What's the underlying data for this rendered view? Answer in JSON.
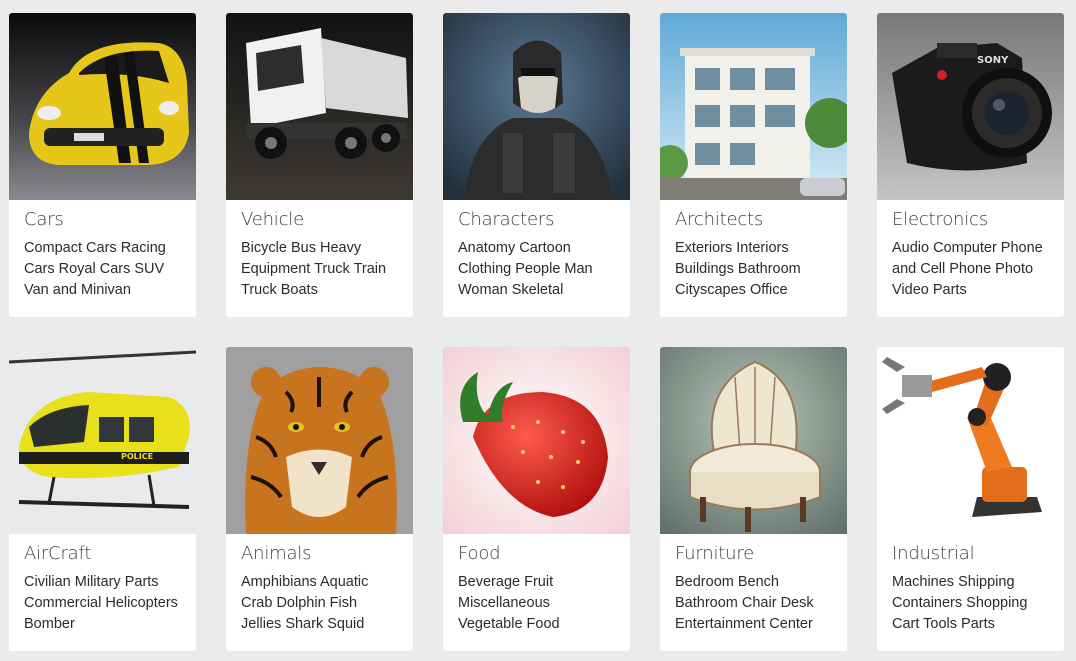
{
  "categories": [
    {
      "title": "Cars",
      "description": "Compact Cars Racing Cars Royal Cars SUV Van and Minivan",
      "image": "car"
    },
    {
      "title": "Vehicle",
      "description": "Bicycle Bus Heavy Equipment Truck Train Truck Boats",
      "image": "truck"
    },
    {
      "title": "Characters",
      "description": "Anatomy Cartoon Clothing People Man Woman Skeletal",
      "image": "soldier"
    },
    {
      "title": "Architects",
      "description": "Exteriors Interiors Buildings Bathroom Cityscapes Office",
      "image": "building"
    },
    {
      "title": "Electronics",
      "description": "Audio Computer Phone and Cell Phone Photo Video Parts",
      "image": "camera"
    },
    {
      "title": "AirCraft",
      "description": "Civilian Military Parts Commercial Helicopters Bomber",
      "image": "helicopter"
    },
    {
      "title": "Animals",
      "description": "Amphibians Aquatic Crab Dolphin Fish Jellies Shark Squid",
      "image": "tiger"
    },
    {
      "title": "Food",
      "description": "Beverage Fruit Miscellaneous Vegetable Food",
      "image": "strawberry"
    },
    {
      "title": "Furniture",
      "description": "Bedroom Bench Bathroom Chair Desk Entertainment Center",
      "image": "chair"
    },
    {
      "title": "Industrial",
      "description": "Machines Shipping Containers Shopping Cart Tools Parts",
      "image": "robot-arm"
    }
  ]
}
